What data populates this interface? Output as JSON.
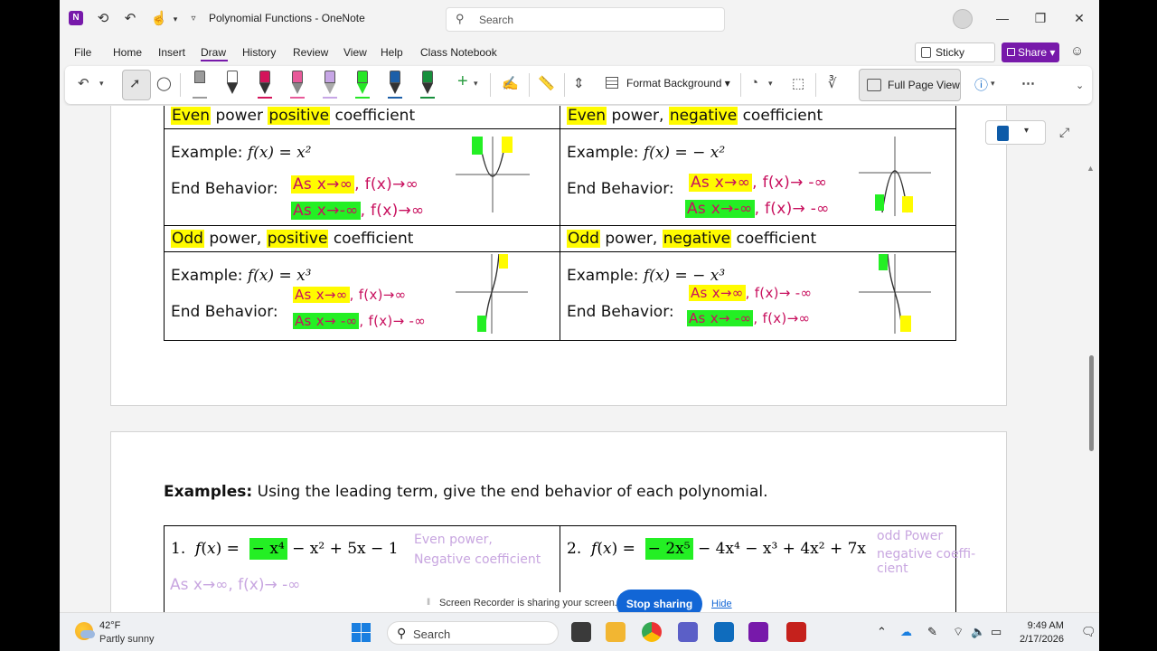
{
  "window": {
    "title": "Polynomial Functions  -  OneNote",
    "search_placeholder": "Search"
  },
  "menu": {
    "items": [
      "File",
      "Home",
      "Insert",
      "Draw",
      "History",
      "Review",
      "View",
      "Help",
      "Class Notebook"
    ],
    "active": "Draw",
    "sticky_notes": "Sticky Notes",
    "share": "Share"
  },
  "ribbon": {
    "format_background": "Format Background",
    "full_page_view": "Full Page View",
    "pen_colors": [
      "#9b9b9b",
      "#ffffff",
      "#d4145a",
      "#e85a9a",
      "#c7a6e6",
      "#27e627",
      "#1c5fa8",
      "#178f3c"
    ],
    "accent": "#7719aa"
  },
  "page": {
    "table": {
      "headers": [
        [
          "Even",
          " power ",
          "positive",
          " coefficient"
        ],
        [
          "Even",
          " power, ",
          "negative",
          " coefficient"
        ],
        [
          "Odd",
          " power, ",
          "positive",
          " coefficient"
        ],
        [
          "Odd",
          " power, ",
          "negative",
          " coefficient"
        ]
      ],
      "example_label": "Example:",
      "end_behavior_label": "End Behavior:",
      "equations": [
        "f(x) = x²",
        "f(x) =   − x²",
        "f(x) = x³",
        "f(x) =   − x³"
      ],
      "ink": [
        [
          "As x→∞",
          ", f(x)→∞",
          "As x→-∞",
          ", f(x)→∞"
        ],
        [
          "As x→∞",
          ", f(x)→ -∞",
          "As x→-∞",
          ", f(x)→ -∞"
        ],
        [
          "As x→∞",
          ", f(x)→∞",
          "As x→ -∞",
          ", f(x)→ -∞"
        ],
        [
          "As x→∞",
          ", f(x)→ -∞",
          "As x→ -∞",
          ", f(x)→∞"
        ]
      ]
    },
    "examples_heading": "Examples:",
    "examples_text": " Using the leading term, give the end behavior of each polynomial.",
    "problems": [
      {
        "num": "1.",
        "lead": "− x⁴",
        "rest": " − x² + 5x − 1",
        "note1": "Even power,",
        "note2": "Negative coefficient",
        "ans": "As x→∞, f(x)→ -∞"
      },
      {
        "num": "2.",
        "lead": "− 2x⁵",
        "rest": " − 4x⁴ − x³ + 4x² + 7x",
        "note1": "odd Power",
        "note2": "negative coeffi-",
        "note3": "cient"
      }
    ]
  },
  "recorder": {
    "text": "Screen Recorder is sharing your screen.",
    "stop": "Stop sharing",
    "hide": "Hide"
  },
  "taskbar": {
    "temp": "42°F",
    "condition": "Partly sunny",
    "search": "Search",
    "time": "9:49 AM",
    "date": "2/17/2026"
  }
}
